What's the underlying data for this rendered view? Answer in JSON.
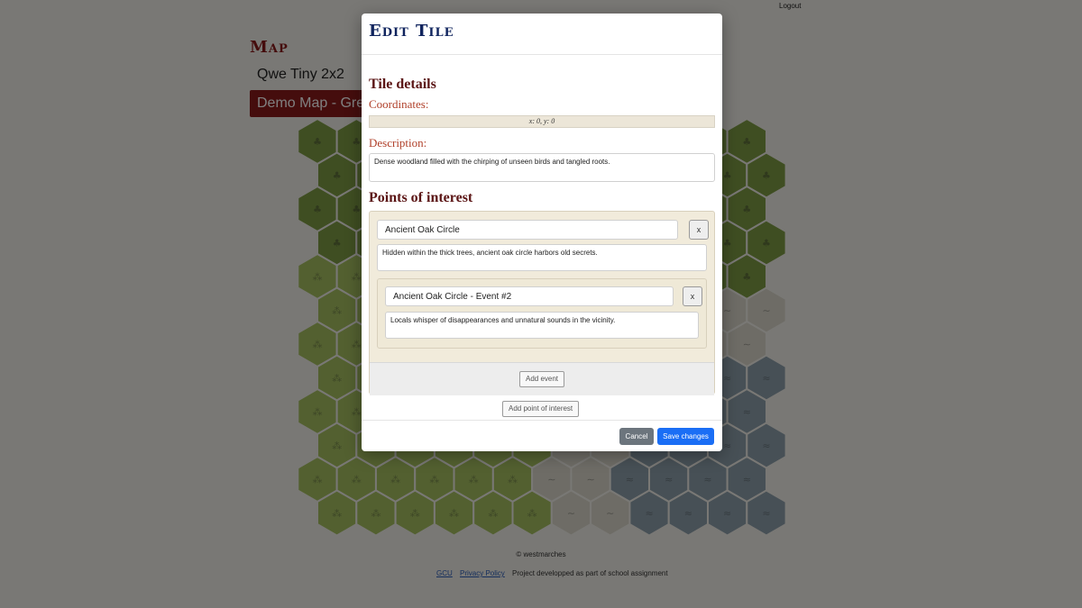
{
  "header": {
    "logout_label": "Logout"
  },
  "page": {
    "heading": "Map",
    "maps": [
      {
        "label": "Qwe Tiny 2x2",
        "active": false
      },
      {
        "label": "Demo Map - Gre",
        "active": true
      }
    ]
  },
  "footer": {
    "copyright": "© westmarches",
    "links": [
      "GCU",
      "Privacy Policy"
    ],
    "note": "Project developped as part of school assignment"
  },
  "modal": {
    "title": "Edit Tile",
    "tile_details_heading": "Tile details",
    "coordinates_label": "Coordinates:",
    "coordinates_value": "x: 0, y: 0",
    "description_label": "Description:",
    "description_value": "Dense woodland filled with the chirping of unseen birds and tangled roots.",
    "poi_heading": "Points of interest",
    "points_of_interest": [
      {
        "name": "Ancient Oak Circle",
        "description": "Hidden within the thick trees, ancient oak circle harbors old secrets.",
        "remove_label": "x",
        "events": [
          {
            "name": "Ancient Oak Circle - Event #2",
            "description": "Locals whisper of disappearances and unnatural sounds in the vicinity.",
            "remove_label": "x"
          }
        ],
        "add_event_label": "Add event"
      }
    ],
    "add_poi_label": "Add point of interest",
    "cancel_label": "Cancel",
    "save_label": "Save changes"
  },
  "colors": {
    "accent": "#8b1a1a",
    "modal_title": "#10245e",
    "primary_button": "#1a6ef5",
    "secondary_button": "#6c757d",
    "forest_tile": "#7e9c44",
    "plains_tile": "#a6c160",
    "sand_tile": "#dcd9cc",
    "water_tile": "#8ea1ad"
  },
  "map_tiles": {
    "terrain_icons": {
      "forest": "tree-icon",
      "plains": "grass-icon",
      "sand": "dune-icon",
      "water": "wave-icon"
    }
  }
}
